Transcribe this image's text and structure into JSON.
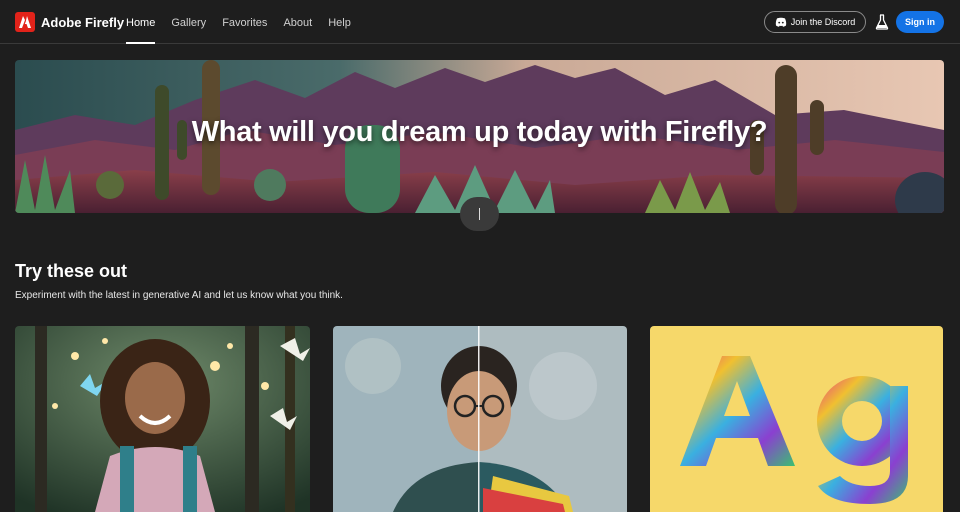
{
  "app": {
    "brand": "Adobe Firefly",
    "brand_color": "#e2231a",
    "accent_color": "#1473e6"
  },
  "nav": {
    "items": [
      {
        "label": "Home",
        "active": true
      },
      {
        "label": "Gallery",
        "active": false
      },
      {
        "label": "Favorites",
        "active": false
      },
      {
        "label": "About",
        "active": false
      },
      {
        "label": "Help",
        "active": false
      }
    ]
  },
  "header": {
    "discord_label": "Join the Discord",
    "discord_icon": "discord-icon",
    "labs_icon": "flask-icon",
    "signin_label": "Sign in"
  },
  "hero": {
    "title": "What will you dream up today with Firefly?"
  },
  "section": {
    "title": "Try these out",
    "subtitle": "Experiment with the latest in generative AI and let us know what you think."
  },
  "cards": [
    {
      "image": "girl-with-butterflies"
    },
    {
      "image": "man-with-glasses-before-after"
    },
    {
      "image": "colorful-fur-text-Ag"
    }
  ]
}
